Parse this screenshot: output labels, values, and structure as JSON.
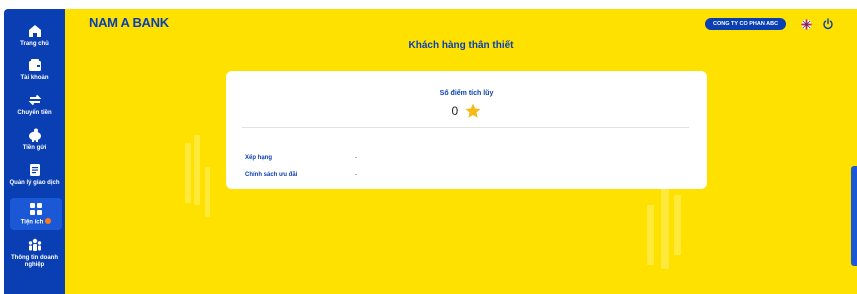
{
  "sidebar": {
    "items": [
      {
        "label": "Trang chủ",
        "icon": "home-icon"
      },
      {
        "label": "Tài khoản",
        "icon": "wallet-icon"
      },
      {
        "label": "Chuyển tiền",
        "icon": "transfer-icon"
      },
      {
        "label": "Tiền gửi",
        "icon": "piggy-bank-icon"
      },
      {
        "label": "Quản lý giao dịch",
        "icon": "document-icon"
      },
      {
        "label": "Tiện ích",
        "icon": "grid-icon",
        "active": true,
        "badge": true
      },
      {
        "label": "Thông tin doanh nghiệp",
        "icon": "people-icon"
      }
    ]
  },
  "header": {
    "logo": "NAM A BANK",
    "company": "CONG TY CO PHAN ABC",
    "title": "Khách hàng thân thiết"
  },
  "loyalty": {
    "points_label": "Số điểm tích lũy",
    "points_value": "0",
    "rows": [
      {
        "label": "Xếp hạng",
        "value": "-"
      },
      {
        "label": "Chính sách ưu đãi",
        "value": "-"
      }
    ]
  },
  "colors": {
    "brand_blue": "#0a3fb3",
    "brand_yellow": "#ffe100",
    "star": "#f5b918"
  }
}
